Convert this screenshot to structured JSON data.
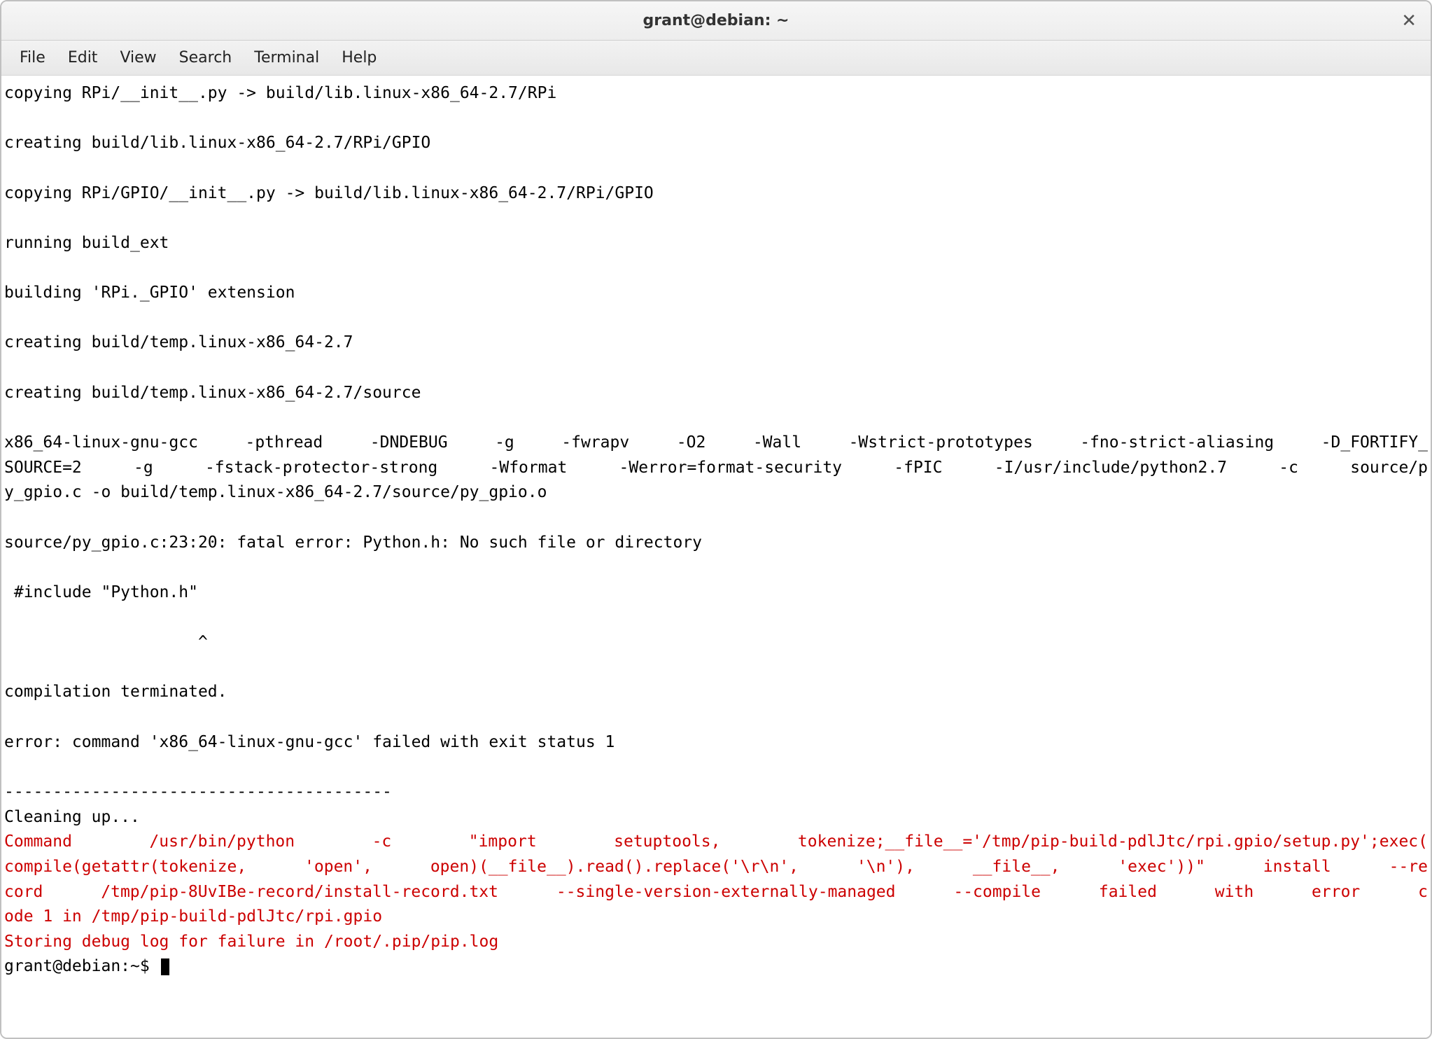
{
  "window": {
    "title": "grant@debian: ~"
  },
  "menu": {
    "file": "File",
    "edit": "Edit",
    "view": "View",
    "search": "Search",
    "terminal": "Terminal",
    "help": "Help"
  },
  "term": {
    "l1": "copying RPi/__init__.py -> build/lib.linux-x86_64-2.7/RPi",
    "l2": "",
    "l3": "creating build/lib.linux-x86_64-2.7/RPi/GPIO",
    "l4": "",
    "l5": "copying RPi/GPIO/__init__.py -> build/lib.linux-x86_64-2.7/RPi/GPIO",
    "l6": "",
    "l7": "running build_ext",
    "l8": "",
    "l9": "building 'RPi._GPIO' extension",
    "l10": "",
    "l11": "creating build/temp.linux-x86_64-2.7",
    "l12": "",
    "l13": "creating build/temp.linux-x86_64-2.7/source",
    "l14": "",
    "gcc1": "x86_64-linux-gnu-gcc -pthread -DNDEBUG -g -fwrapv -O2 -Wall -Wstrict-prototypes -fno-strict-aliasing -D_FORTIFY_",
    "gcc2": "SOURCE=2 -g -fstack-protector-strong -Wformat -Werror=format-security -fPIC -I/usr/include/python2.7 -c source/p",
    "gcc3": "y_gpio.c -o build/temp.linux-x86_64-2.7/source/py_gpio.o",
    "l16": "",
    "l17": "source/py_gpio.c:23:20: fatal error: Python.h: No such file or directory",
    "l18": "",
    "l19": " #include \"Python.h\"",
    "l20": "",
    "l21": "                    ^",
    "l22": "",
    "l23": "compilation terminated.",
    "l24": "",
    "l25": "error: command 'x86_64-linux-gnu-gcc' failed with exit status 1",
    "l26": "",
    "l27": "----------------------------------------",
    "l28": "Cleaning up...",
    "e1": "Command /usr/bin/python -c \"import setuptools, tokenize;__file__='/tmp/pip-build-pdlJtc/rpi.gpio/setup.py';exec(",
    "e2": "compile(getattr(tokenize, 'open', open)(__file__).read().replace('\\r\\n', '\\n'), __file__, 'exec'))\" install --re",
    "e3": "cord /tmp/pip-8UvIBe-record/install-record.txt --single-version-externally-managed --compile failed with error c",
    "e4": "ode 1 in /tmp/pip-build-pdlJtc/rpi.gpio",
    "e5": "Storing debug log for failure in /root/.pip/pip.log",
    "prompt": "grant@debian:~$ "
  }
}
